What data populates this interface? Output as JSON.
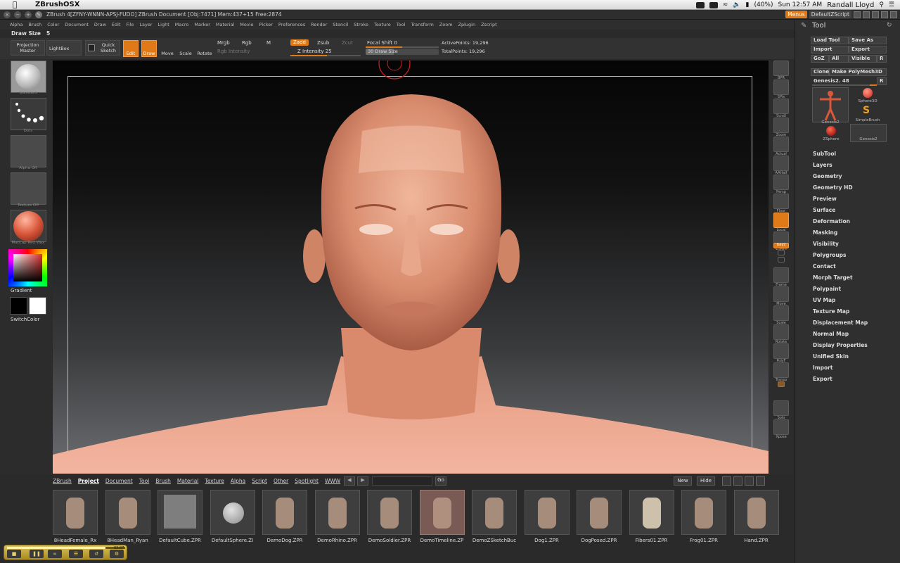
{
  "macbar": {
    "app_name": "ZBrushOSX",
    "clock": "Sun 12:57 AM",
    "user": "Randall Lloyd",
    "battery": "(40%)"
  },
  "titlebar": {
    "text": "ZBrush 4[ZFNY-WNNN-APSJ-FUDO]    ZBrush Document    [Obj:7471] Mem:437+15 Free:2874",
    "menus_label": "Menus",
    "script_label": "DefaultZScript"
  },
  "menu": [
    "Alpha",
    "Brush",
    "Color",
    "Document",
    "Draw",
    "Edit",
    "File",
    "Layer",
    "Light",
    "Macro",
    "Marker",
    "Material",
    "Movie",
    "Picker",
    "Preferences",
    "Render",
    "Stencil",
    "Stroke",
    "Texture",
    "Tool",
    "Transform",
    "Zoom",
    "Zplugin",
    "Zscript"
  ],
  "draw_size": {
    "label": "Draw Size",
    "value": "5"
  },
  "shelf": {
    "projection_master": "Projection Master",
    "lightbox": "LightBox",
    "quick_sketch": "Quick Sketch",
    "edit": "Edit",
    "draw": "Draw",
    "move": "Move",
    "scale": "Scale",
    "rotate": "Rotate",
    "mrgb": "Mrgb",
    "rgb": "Rgb",
    "m": "M",
    "rgb_intensity": "Rgb Intensity",
    "zadd": "Zadd",
    "zsub": "Zsub",
    "zcut": "Zcut",
    "z_intensity": "Z Intensity 25",
    "focal_shift": "Focal Shift 0",
    "draw_size_slider": "30 Draw Size",
    "active_points": "ActivePoints: 19,296",
    "total_points": "TotalPoints: 19,296"
  },
  "left_tray": {
    "brush": "Standard",
    "stroke": "Dots",
    "alpha": "Alpha Off",
    "texture": "Texture Off",
    "material": "MatCap Red Wax",
    "gradient": "Gradient",
    "switch_color": "SwitchColor"
  },
  "right_tray": [
    "BPR",
    "SPix",
    "Scroll",
    "Zoom",
    "Actual",
    "AAHalf",
    "Persp",
    "Floor",
    "Local",
    "L.Sym",
    "Gxyz",
    "",
    "",
    "Frame",
    "Move",
    "Scale",
    "Rotate",
    "PolyF",
    "Transp",
    "",
    "Solo",
    "Xpose"
  ],
  "tool": {
    "title": "Tool",
    "load_tool": "Load Tool",
    "save_as": "Save As",
    "import": "Import",
    "export": "Export",
    "goz": "GoZ",
    "all": "All",
    "visible": "Visible",
    "r": "R",
    "clone": "Clone",
    "make_polymesh": "Make PolyMesh3D",
    "current_tool": "Genesis2. 48",
    "thumbs": [
      "Genesis2",
      "Sphere3D",
      "SimpleBrush",
      "ZSphere",
      "Genesis2"
    ],
    "sections": [
      "SubTool",
      "Layers",
      "Geometry",
      "Geometry HD",
      "Preview",
      "Surface",
      "Deformation",
      "Masking",
      "Visibility",
      "Polygroups",
      "Contact",
      "Morph Target",
      "Polypaint",
      "UV Map",
      "Texture Map",
      "Displacement Map",
      "Normal Map",
      "Display Properties",
      "Unified Skin",
      "Import",
      "Export"
    ]
  },
  "lightbox": {
    "tabs": [
      "ZBrush",
      "Project",
      "Document",
      "Tool",
      "Brush",
      "Material",
      "Texture",
      "Alpha",
      "Script",
      "Other",
      "Spotlight",
      "WWW"
    ],
    "active_tab": "Project",
    "go": "Go",
    "new": "New",
    "hide": "Hide",
    "items": [
      "8HeadFemale_Rx",
      "8HeadMan_Ryan",
      "DefaultCube.ZPR",
      "DefaultSphere.ZI",
      "DemoDog.ZPR",
      "DemoRhino.ZPR",
      "DemoSoldier.ZPR",
      "DemoTimeline.ZP",
      "DemoZSketchBuc",
      "Dog1.ZPR",
      "DogPosed.ZPR",
      "Fibers01.ZPR",
      "Frog01.ZPR",
      "Hand.ZPR"
    ]
  },
  "video": {
    "time": "02:07"
  },
  "colors": {
    "accent": "#e07a18",
    "panel": "#2f2f2f",
    "skin": "#e2987a"
  }
}
